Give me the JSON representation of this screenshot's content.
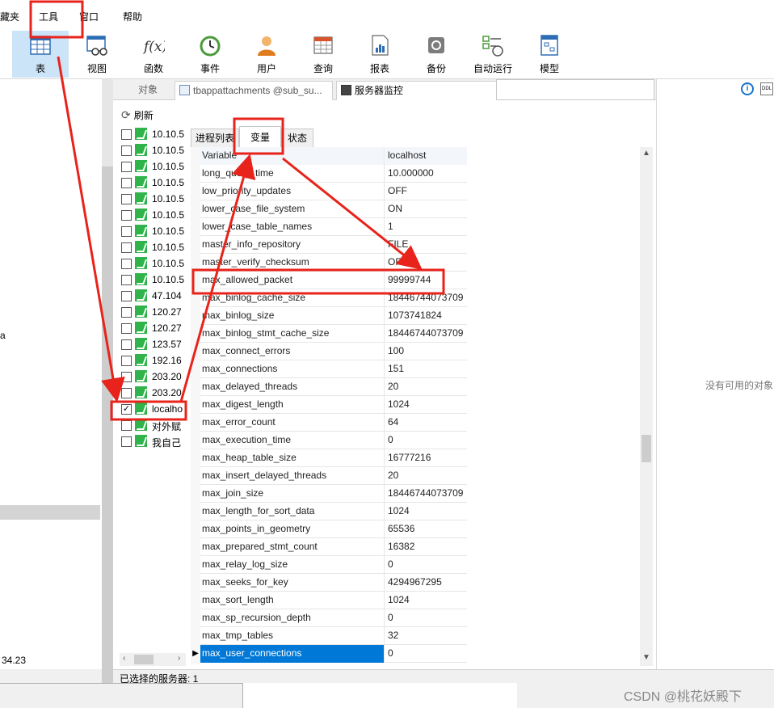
{
  "menu": {
    "items": [
      "藏夹",
      "工具",
      "窗口",
      "帮助"
    ]
  },
  "toolbar": {
    "buttons": [
      {
        "label": "表",
        "icon": "table-icon"
      },
      {
        "label": "视图",
        "icon": "view-icon"
      },
      {
        "label": "函数",
        "icon": "function-icon"
      },
      {
        "label": "事件",
        "icon": "event-clock-icon"
      },
      {
        "label": "用户",
        "icon": "user-icon"
      },
      {
        "label": "查询",
        "icon": "query-icon"
      },
      {
        "label": "报表",
        "icon": "report-icon"
      },
      {
        "label": "备份",
        "icon": "backup-icon"
      },
      {
        "label": "自动运行",
        "icon": "autorun-icon"
      },
      {
        "label": "模型",
        "icon": "model-icon"
      }
    ],
    "function_glyph": "f(x)"
  },
  "left": {
    "frag_a": "a",
    "version": "34.23"
  },
  "tabs": {
    "objects": "对象",
    "table_tab": "tbappattachments @sub_su...",
    "monitor": "服务器监控"
  },
  "monitor": {
    "refresh": "刷新",
    "servers": [
      {
        "name": "10.10.5",
        "checked": false
      },
      {
        "name": "10.10.5",
        "checked": false
      },
      {
        "name": "10.10.5",
        "checked": false
      },
      {
        "name": "10.10.5",
        "checked": false
      },
      {
        "name": "10.10.5",
        "checked": false
      },
      {
        "name": "10.10.5",
        "checked": false
      },
      {
        "name": "10.10.5",
        "checked": false
      },
      {
        "name": "10.10.5",
        "checked": false
      },
      {
        "name": "10.10.5",
        "checked": false
      },
      {
        "name": "10.10.5",
        "checked": false
      },
      {
        "name": "47.104",
        "checked": false
      },
      {
        "name": "120.27",
        "checked": false
      },
      {
        "name": "120.27",
        "checked": false
      },
      {
        "name": "123.57",
        "checked": false
      },
      {
        "name": "192.16",
        "checked": false
      },
      {
        "name": "203.20",
        "checked": false
      },
      {
        "name": "203.20",
        "checked": false
      },
      {
        "name": "localho",
        "checked": true
      },
      {
        "name": "对外赋",
        "checked": false
      },
      {
        "name": "我自己",
        "checked": false
      }
    ],
    "subtabs": {
      "process": "进程列表",
      "variables": "变量",
      "status": "状态"
    },
    "variables_header": {
      "key": "Variable",
      "value": "localhost"
    },
    "variables": [
      {
        "key": "long_query_time",
        "value": "10.000000"
      },
      {
        "key": "low_priority_updates",
        "value": "OFF"
      },
      {
        "key": "lower_case_file_system",
        "value": "ON"
      },
      {
        "key": "lower_case_table_names",
        "value": "1"
      },
      {
        "key": "master_info_repository",
        "value": "FILE"
      },
      {
        "key": "master_verify_checksum",
        "value": "OFF"
      },
      {
        "key": "max_allowed_packet",
        "value": "99999744"
      },
      {
        "key": "max_binlog_cache_size",
        "value": "18446744073709"
      },
      {
        "key": "max_binlog_size",
        "value": "1073741824"
      },
      {
        "key": "max_binlog_stmt_cache_size",
        "value": "18446744073709"
      },
      {
        "key": "max_connect_errors",
        "value": "100"
      },
      {
        "key": "max_connections",
        "value": "151"
      },
      {
        "key": "max_delayed_threads",
        "value": "20"
      },
      {
        "key": "max_digest_length",
        "value": "1024"
      },
      {
        "key": "max_error_count",
        "value": "64"
      },
      {
        "key": "max_execution_time",
        "value": "0"
      },
      {
        "key": "max_heap_table_size",
        "value": "16777216"
      },
      {
        "key": "max_insert_delayed_threads",
        "value": "20"
      },
      {
        "key": "max_join_size",
        "value": "18446744073709"
      },
      {
        "key": "max_length_for_sort_data",
        "value": "1024"
      },
      {
        "key": "max_points_in_geometry",
        "value": "65536"
      },
      {
        "key": "max_prepared_stmt_count",
        "value": "16382"
      },
      {
        "key": "max_relay_log_size",
        "value": "0"
      },
      {
        "key": "max_seeks_for_key",
        "value": "4294967295"
      },
      {
        "key": "max_sort_length",
        "value": "1024"
      },
      {
        "key": "max_sp_recursion_depth",
        "value": "0"
      },
      {
        "key": "max_tmp_tables",
        "value": "32"
      },
      {
        "key": "max_user_connections",
        "value": "0"
      }
    ],
    "selected_index": 27
  },
  "right": {
    "info": "i",
    "ddl": "DDL",
    "empty_text": "没有可用的对象"
  },
  "statusbar": {
    "selected_servers": "已选择的服务器: 1"
  },
  "watermark": "CSDN @桃花妖殿下",
  "colors": {
    "annotation": "#e8231b",
    "selection": "#0078d7",
    "dolphin": "#2fb34a"
  }
}
